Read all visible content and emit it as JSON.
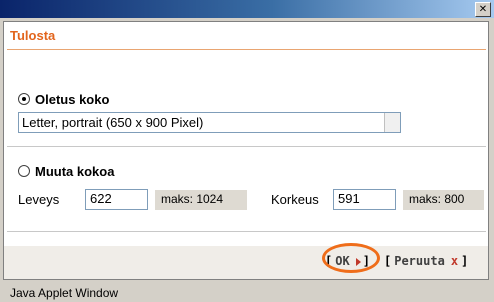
{
  "window": {
    "close_glyph": "✕"
  },
  "dialog": {
    "title": "Tulosta",
    "default_size": {
      "label": "Oletus koko",
      "selected": true,
      "select_value": "Letter, portrait (650 x 900 Pixel)"
    },
    "custom_size": {
      "label": "Muuta kokoa",
      "selected": false,
      "width_label": "Leveys",
      "width_value": "622",
      "width_max": "maks: 1024",
      "height_label": "Korkeus",
      "height_value": "591",
      "height_max": "maks: 800"
    },
    "buttons": {
      "open_bracket": "[",
      "close_bracket": "]",
      "ok_label": "OK",
      "cancel_label": "Peruuta",
      "cancel_mark": "x"
    }
  },
  "status_bar": {
    "text": "Java Applet Window"
  },
  "colors": {
    "accent": "#e2651d",
    "highlight": "#ef6d1a",
    "titlebar": "#0a246a"
  }
}
